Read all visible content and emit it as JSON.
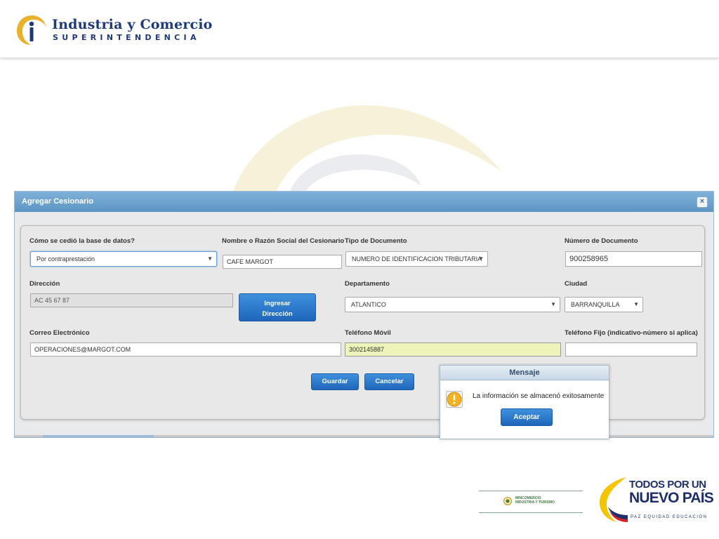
{
  "header": {
    "logo_title": "Industria y Comercio",
    "logo_subtitle": "SUPERINTENDENCIA"
  },
  "dialog": {
    "title": "Agregar Cesionario",
    "close_label": "×",
    "form": {
      "metodo": {
        "label": "Cómo se cedió la base de datos?",
        "value": "Por contraprestación"
      },
      "razon_social": {
        "label": "Nombre o Razón Social del Cesionario",
        "value": "CAFE MARGOT"
      },
      "tipo_documento": {
        "label": "Tipo de Documento",
        "value": "NUMERO DE IDENTIFICACION TRIBUTARIA"
      },
      "numero_documento": {
        "label": "Número de Documento",
        "value": "900258965"
      },
      "direccion": {
        "label": "Dirección",
        "value": "AC 45 67 87"
      },
      "ingresar_direccion": {
        "line1": "Ingresar",
        "line2": "Dirección"
      },
      "departamento": {
        "label": "Departamento",
        "value": "ATLANTICO"
      },
      "ciudad": {
        "label": "Ciudad",
        "value": "BARRANQUILLA"
      },
      "correo": {
        "label": "Correo Electrónico",
        "value": "OPERACIONES@MARGOT.COM"
      },
      "telefono_movil": {
        "label": "Teléfono Móvil",
        "value": "3002145887"
      },
      "telefono_fijo": {
        "label": "Teléfono Fijo (indicativo-número si aplica)",
        "value": ""
      }
    },
    "buttons": {
      "save": "Guardar",
      "cancel": "Cancelar"
    }
  },
  "message": {
    "title": "Mensaje",
    "text": "La información se almacenó exitosamente",
    "accept": "Aceptar",
    "icon": "warning-icon"
  },
  "footer": {
    "ministry": {
      "line1": "MINCOMERCIO",
      "line2": "INDUSTRIA Y TURISMO"
    },
    "slogan": {
      "line1": "TODOS POR UN",
      "line2": "NUEVO PAÍS",
      "line3": "PAZ  EQUIDAD  EDUCACIÓN"
    }
  },
  "colors": {
    "accent": "#1f66bb",
    "title_bar": "#6aa0cc",
    "highlight_field": "#edf3b9",
    "brand_navy": "#1f3a7a",
    "brand_gold": "#e8b22c"
  }
}
